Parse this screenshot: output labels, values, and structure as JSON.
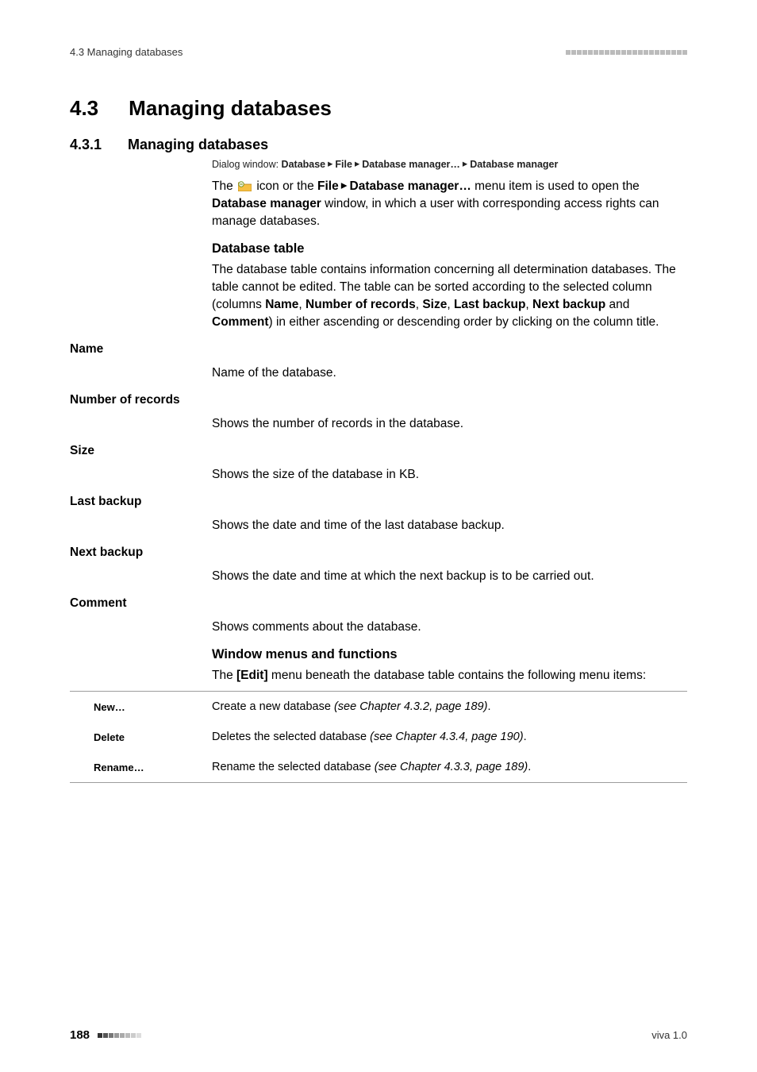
{
  "header": {
    "left": "4.3 Managing databases"
  },
  "section": {
    "number": "4.3",
    "title": "Managing databases"
  },
  "subsection": {
    "number": "4.3.1",
    "title": "Managing databases"
  },
  "dialog": {
    "prefix": "Dialog window: ",
    "p1": "Database",
    "p2": "File",
    "p3": "Database manager…",
    "p4": "Database manager"
  },
  "intro": {
    "t1": "The ",
    "t2": " icon or the ",
    "b1": "File",
    "tri": " ▸ ",
    "b2": "Database manager…",
    "t3": " menu item is used to open the ",
    "b3": "Database manager",
    "t4": " window, in which a user with corresponding access rights can manage databases."
  },
  "dbtable": {
    "heading": "Database table",
    "p_t1": "The database table contains information concerning all determination databases. The table cannot be edited. The table can be sorted according to the selected column (columns ",
    "p_b1": "Name",
    "p_sep1": ", ",
    "p_b2": "Number of records",
    "p_sep2": ", ",
    "p_b3": "Size",
    "p_sep3": ", ",
    "p_b4": "Last backup",
    "p_sep4": ", ",
    "p_b5": "Next backup",
    "p_and": " and ",
    "p_b6": "Comment",
    "p_t2": ") in either ascending or descending order by clicking on the column title."
  },
  "defs": [
    {
      "term": "Name",
      "def": "Name of the database."
    },
    {
      "term": "Number of records",
      "def": "Shows the number of records in the database."
    },
    {
      "term": "Size",
      "def": "Shows the size of the database in KB."
    },
    {
      "term": "Last backup",
      "def": "Shows the date and time of the last database backup."
    },
    {
      "term": "Next backup",
      "def": "Shows the date and time at which the next backup is to be carried out."
    },
    {
      "term": "Comment",
      "def": "Shows comments about the database."
    }
  ],
  "windowmenus": {
    "heading": "Window menus and functions",
    "p_t1": "The ",
    "p_b1": "[Edit]",
    "p_t2": " menu beneath the database table contains the following menu items:"
  },
  "menu": [
    {
      "label": "New…",
      "text": "Create a new database ",
      "ref": "(see Chapter 4.3.2, page 189)",
      "suffix": "."
    },
    {
      "label": "Delete",
      "text": "Deletes the selected database ",
      "ref": "(see Chapter 4.3.4, page 190)",
      "suffix": "."
    },
    {
      "label": "Rename…",
      "text": "Rename the selected database ",
      "ref": "(see Chapter 4.3.3, page 189)",
      "suffix": "."
    }
  ],
  "footer": {
    "page": "188",
    "right": "viva 1.0"
  }
}
